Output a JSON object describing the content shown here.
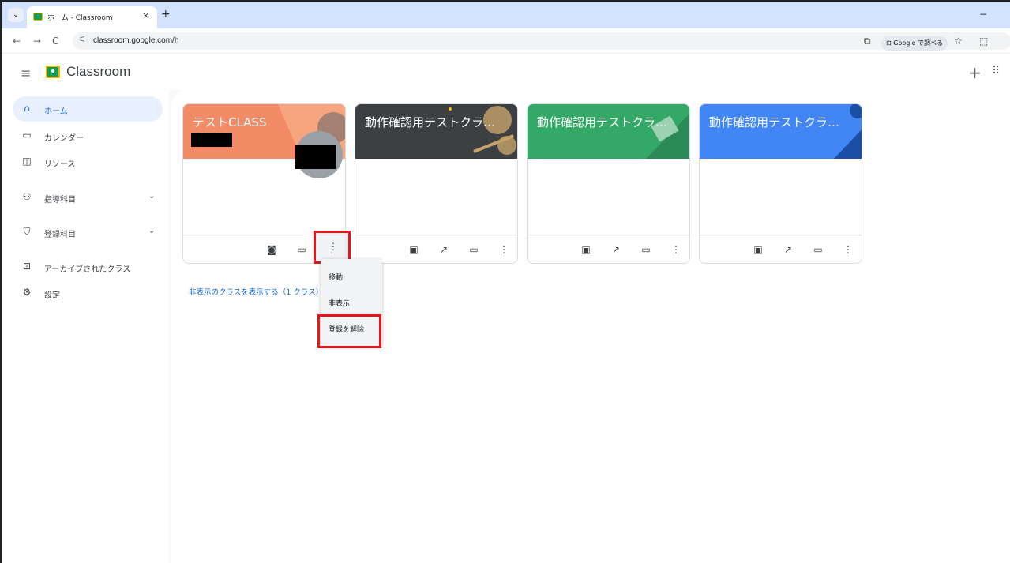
{
  "browser": {
    "tab_title": "ホーム - Classroom",
    "tab_close": "×",
    "new_tab": "+",
    "tab_menu": "⌄",
    "minimize": "−",
    "url": "classroom.google.com/h",
    "back": "←",
    "forward": "→",
    "reload": "C",
    "lens_label": "Google で調べる",
    "star": "☆",
    "extensions": "⬚"
  },
  "app": {
    "title": "Classroom",
    "hamburger": "≡",
    "plus": "+",
    "apps": "⠿"
  },
  "sidebar": {
    "items": [
      {
        "label": "ホーム",
        "icon": "home-icon",
        "glyph": "⌂"
      },
      {
        "label": "カレンダー",
        "icon": "calendar-icon",
        "glyph": "▭"
      },
      {
        "label": "リソース",
        "icon": "resources-icon",
        "glyph": "◫"
      },
      {
        "label": "指導科目",
        "icon": "people-icon",
        "glyph": "⚇"
      },
      {
        "label": "登録科目",
        "icon": "school-icon",
        "glyph": "⛉"
      },
      {
        "label": "アーカイブされたクラス",
        "icon": "archive-icon",
        "glyph": "⊡"
      },
      {
        "label": "設定",
        "icon": "gear-icon",
        "glyph": "⚙"
      }
    ],
    "chevron": "⌄"
  },
  "cards": [
    {
      "title": "テストCLASS",
      "color": "#f28b66"
    },
    {
      "title": "動作確認用テストクラ…",
      "color": "#3c4043"
    },
    {
      "title": "動作確認用テストクラ…",
      "color": "#34a867"
    },
    {
      "title": "動作確認用テストクラ…",
      "color": "#4285f4"
    }
  ],
  "card_icons": {
    "portfolio": "◙",
    "folder": "▭",
    "more": "⋮",
    "gradebook": "▣",
    "trend": "↗"
  },
  "menu": {
    "items": [
      "移動",
      "非表示",
      "登録を解除"
    ]
  },
  "hidden_classes_link": "非表示のクラスを表示する（1 クラス）",
  "colors": {
    "highlight": "#e8161b",
    "accent": "#1967d2"
  }
}
